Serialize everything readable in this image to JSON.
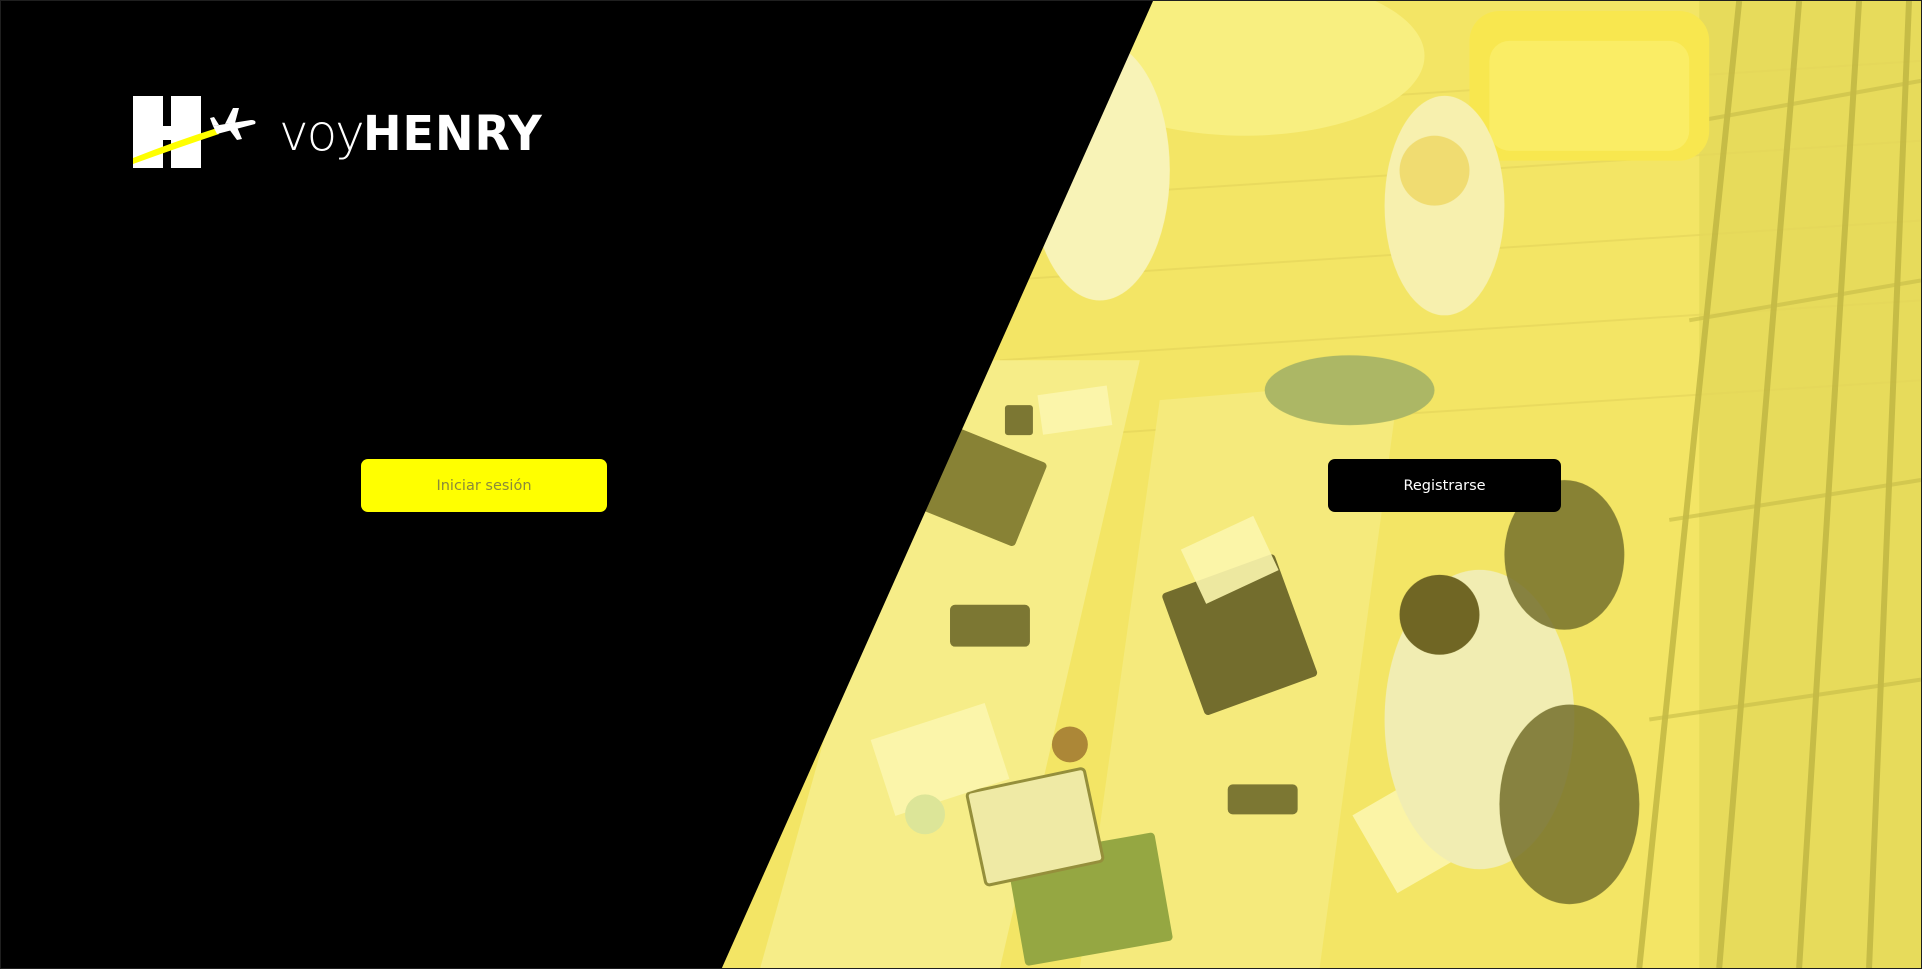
{
  "brand": {
    "logo_prefix": "voy",
    "logo_name": "HENRY"
  },
  "actions": {
    "login_label": "Iniciar sesión",
    "register_label": "Registrarse"
  },
  "colors": {
    "brand_yellow": "#ffff00",
    "panel_black": "#000000",
    "photo_tint": "#f2e866",
    "login_text": "#8a8a3a",
    "register_text": "#ffffff"
  },
  "icons": {
    "logo_mark": "henry-h-airplane-logo-icon"
  },
  "background": {
    "image_subject": "overhead-office-workspace-photo"
  }
}
